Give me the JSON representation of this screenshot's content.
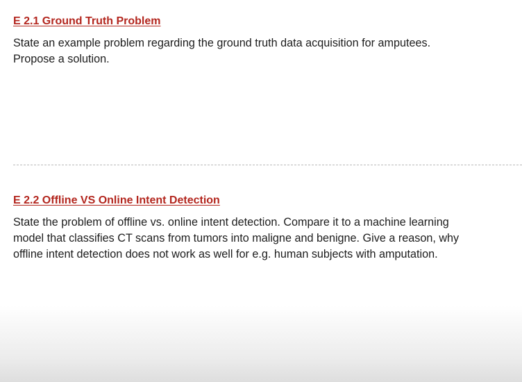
{
  "sections": [
    {
      "heading": "E 2.1 Ground Truth Problem",
      "lines": [
        "State an example problem regarding the ground truth data acquisition for amputees.",
        "Propose a solution."
      ]
    },
    {
      "heading": "E 2.2 Offline VS Online Intent Detection",
      "lines": [
        "State the problem of offline vs. online intent detection. Compare it to a machine learning",
        "model that classifies CT scans from tumors into maligne and benigne. Give a reason, why",
        "offline intent detection does not work as well for e.g. human subjects with amputation."
      ]
    }
  ],
  "colors": {
    "heading": "#b3261e",
    "text": "#1c1c1c",
    "divider": "#b9b9b9"
  }
}
